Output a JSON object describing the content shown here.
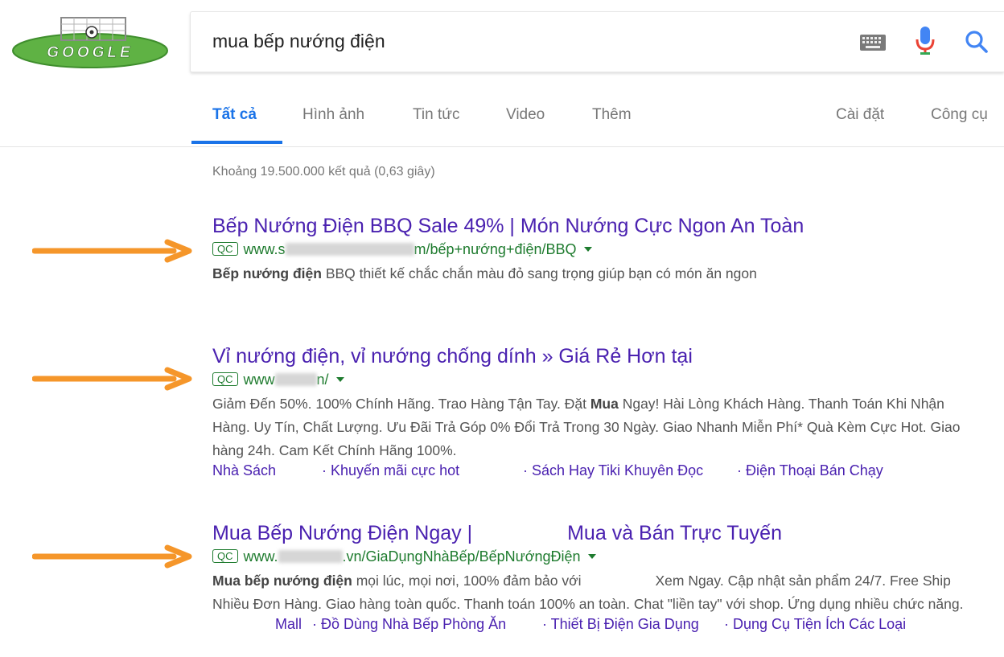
{
  "search": {
    "query": "mua bếp nướng điện"
  },
  "logo": {
    "text": "GOOGLE"
  },
  "tabs": [
    {
      "label": "Tất cả"
    },
    {
      "label": "Hình ảnh"
    },
    {
      "label": "Tin tức"
    },
    {
      "label": "Video"
    },
    {
      "label": "Thêm"
    },
    {
      "label": "Cài đặt"
    },
    {
      "label": "Công cụ"
    }
  ],
  "results_stats": "Khoảng 19.500.000 kết quả (0,63 giây)",
  "ad_badge": "QC",
  "ads": [
    {
      "title": "Bếp Nướng Điện BBQ Sale 49% | Món Nướng Cực Ngon An Toàn",
      "url_prefix": "www.s",
      "url_suffix": "m/bếp+nướng+điện/BBQ",
      "desc_bold": "Bếp nướng điện",
      "desc": " BBQ thiết kế chắc chắn màu đỏ sang trọng giúp bạn có món ăn ngon"
    },
    {
      "title": "Vỉ nướng điện, vỉ nướng chống dính » Giá Rẻ Hơn tại",
      "url_prefix": "www",
      "url_suffix": "n/",
      "desc_pre": "Giảm Đến 50%. 100% Chính Hãng. Trao Hàng Tận Tay. Đặt ",
      "desc_bold": "Mua",
      "desc_post": " Ngay! Hài Lòng Khách Hàng. Thanh Toán Khi Nhận Hàng. Uy Tín, Chất Lượng. Ưu Đãi Trả Góp 0% Đổi Trả Trong 30 Ngày. Giao Nhanh Miễn Phí* Quà Kèm Cực Hot. Giao hàng 24h. Cam Kết Chính Hãng 100%.",
      "sitelinks": [
        "Nhà Sách",
        "· Khuyến mãi cực hot",
        "· Sách Hay Tiki Khuyên Đọc",
        "· Điện Thoại Bán Chạy"
      ]
    },
    {
      "title_a": "Mua Bếp Nướng Điện Ngay |",
      "title_b": "Mua và Bán Trực Tuyến",
      "url_prefix": "www.",
      "url_suffix": ".vn/GiaDụngNhàBếp/BếpNướngĐiện",
      "desc_bold": "Mua bếp nướng điện",
      "desc_a": " mọi lúc, mọi nơi, 100% đảm bảo với",
      "desc_b": "Xem Ngay. Cập nhật sản phẩm 24/7. Free Ship Nhiều Đơn Hàng. Giao hàng toàn quốc. Thanh toán 100% an toàn. Chat \"liền tay\" với shop. Ứng dụng nhiều chức năng.",
      "sitelinks": [
        "Mall",
        "· Đồ Dùng Nhà Bếp Phòng Ăn",
        "· Thiết Bị Điện Gia Dụng",
        "· Dụng Cụ Tiện Ích Các Loại"
      ]
    }
  ],
  "colors": {
    "title": "#4a21b0",
    "url": "#1e7b2e",
    "active_tab": "#1a73e8",
    "arrow": "#f5962a"
  }
}
